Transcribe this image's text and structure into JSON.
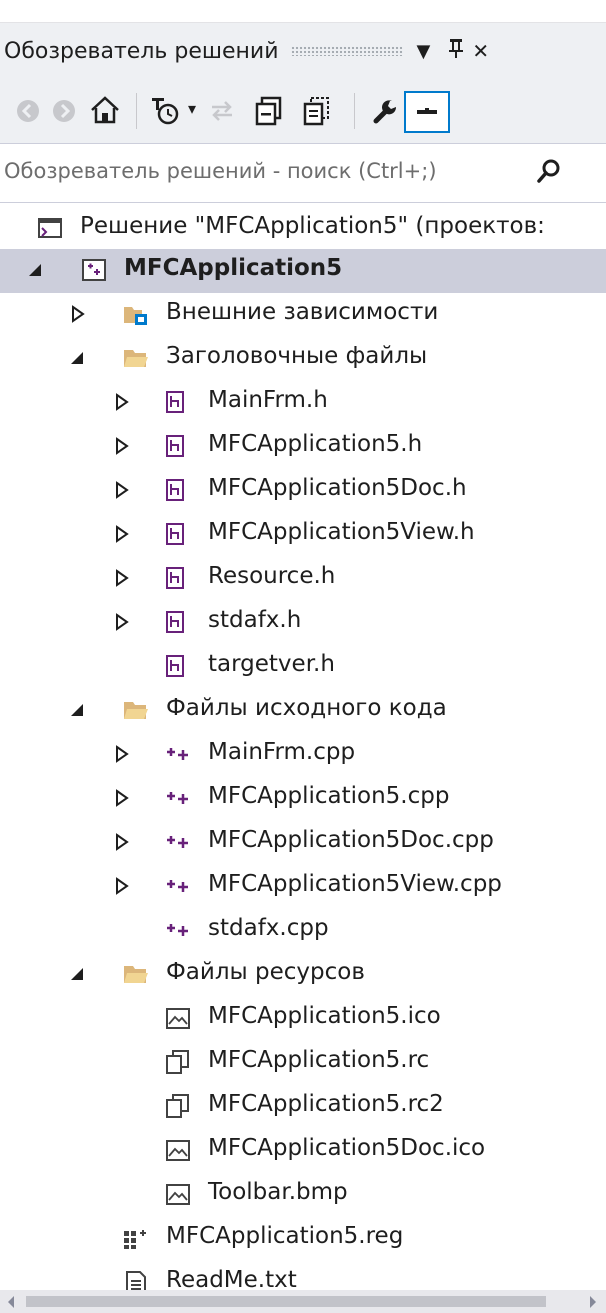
{
  "panel": {
    "title": "Обозреватель решений",
    "dropdown_glyph": "▼",
    "pin_glyph": "ᵽ",
    "close_glyph": "✕"
  },
  "toolbar": {
    "items": [
      "back-icon",
      "forward-icon",
      "home-icon",
      "pending-changes-icon",
      "sync-icon",
      "collapse-all-icon",
      "show-all-files-icon",
      "properties-icon",
      "preview-icon"
    ],
    "dropdown_glyph": "▾"
  },
  "search": {
    "placeholder": "Обозреватель решений - поиск (Ctrl+;)"
  },
  "tree": {
    "solution": "Решение \"MFCApplication5\" (проектов:",
    "project": "MFCApplication5",
    "external": "Внешние зависимости",
    "headers_folder": "Заголовочные файлы",
    "headers": [
      "MainFrm.h",
      "MFCApplication5.h",
      "MFCApplication5Doc.h",
      "MFCApplication5View.h",
      "Resource.h",
      "stdafx.h",
      "targetver.h"
    ],
    "sources_folder": "Файлы исходного кода",
    "sources": [
      "MainFrm.cpp",
      "MFCApplication5.cpp",
      "MFCApplication5Doc.cpp",
      "MFCApplication5View.cpp",
      "stdafx.cpp"
    ],
    "resources_folder": "Файлы ресурсов",
    "resources": [
      "MFCApplication5.ico",
      "MFCApplication5.rc",
      "MFCApplication5.rc2",
      "MFCApplication5Doc.ico",
      "Toolbar.bmp"
    ],
    "reg_file": "MFCApplication5.reg",
    "readme": "ReadMe.txt"
  },
  "colors": {
    "panel_bg": "#eef0f3",
    "selection": "#cccedb",
    "accent_blue": "#007acc",
    "cpp_purple": "#68217a",
    "folder_yellow": "#dcb67a"
  }
}
